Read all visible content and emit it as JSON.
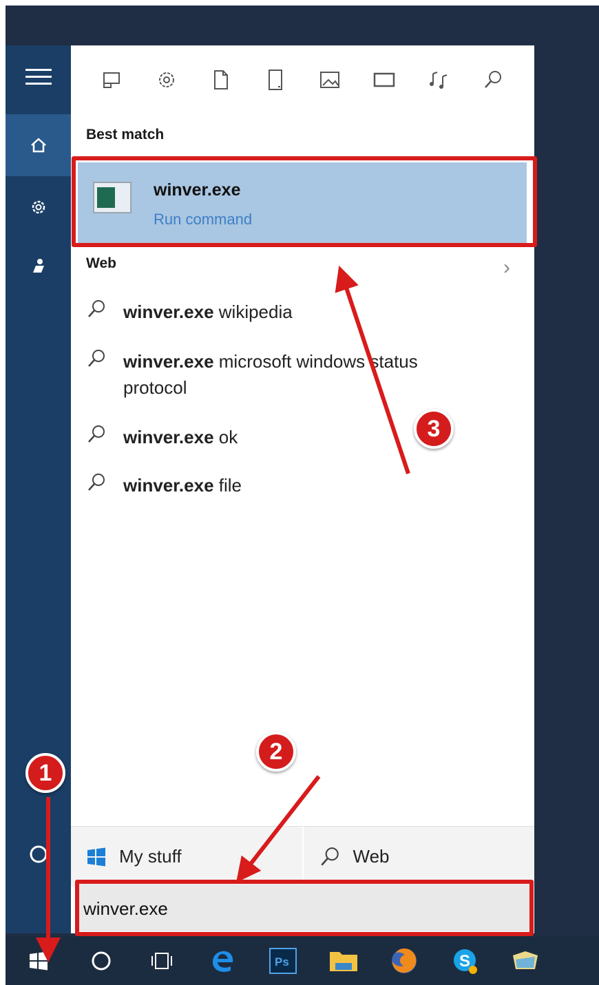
{
  "search_panel": {
    "best_match_heading": "Best match",
    "best_match": {
      "title": "winver.exe",
      "subtitle": "Run command"
    },
    "web_heading": "Web",
    "web_results": [
      {
        "bold": "winver.exe",
        "rest": " wikipedia"
      },
      {
        "bold": "winver.exe",
        "rest": " microsoft windows status protocol"
      },
      {
        "bold": "winver.exe",
        "rest": " ok"
      },
      {
        "bold": "winver.exe",
        "rest": " file"
      }
    ],
    "scope_tabs": {
      "my_stuff": "My stuff",
      "web": "Web"
    },
    "search_value": "winver.exe"
  },
  "annotations": {
    "step1": "1",
    "step2": "2",
    "step3": "3"
  },
  "colors": {
    "accent": "#d81b1b",
    "link": "#3d7fc6",
    "selection": "#a9c6e2"
  }
}
